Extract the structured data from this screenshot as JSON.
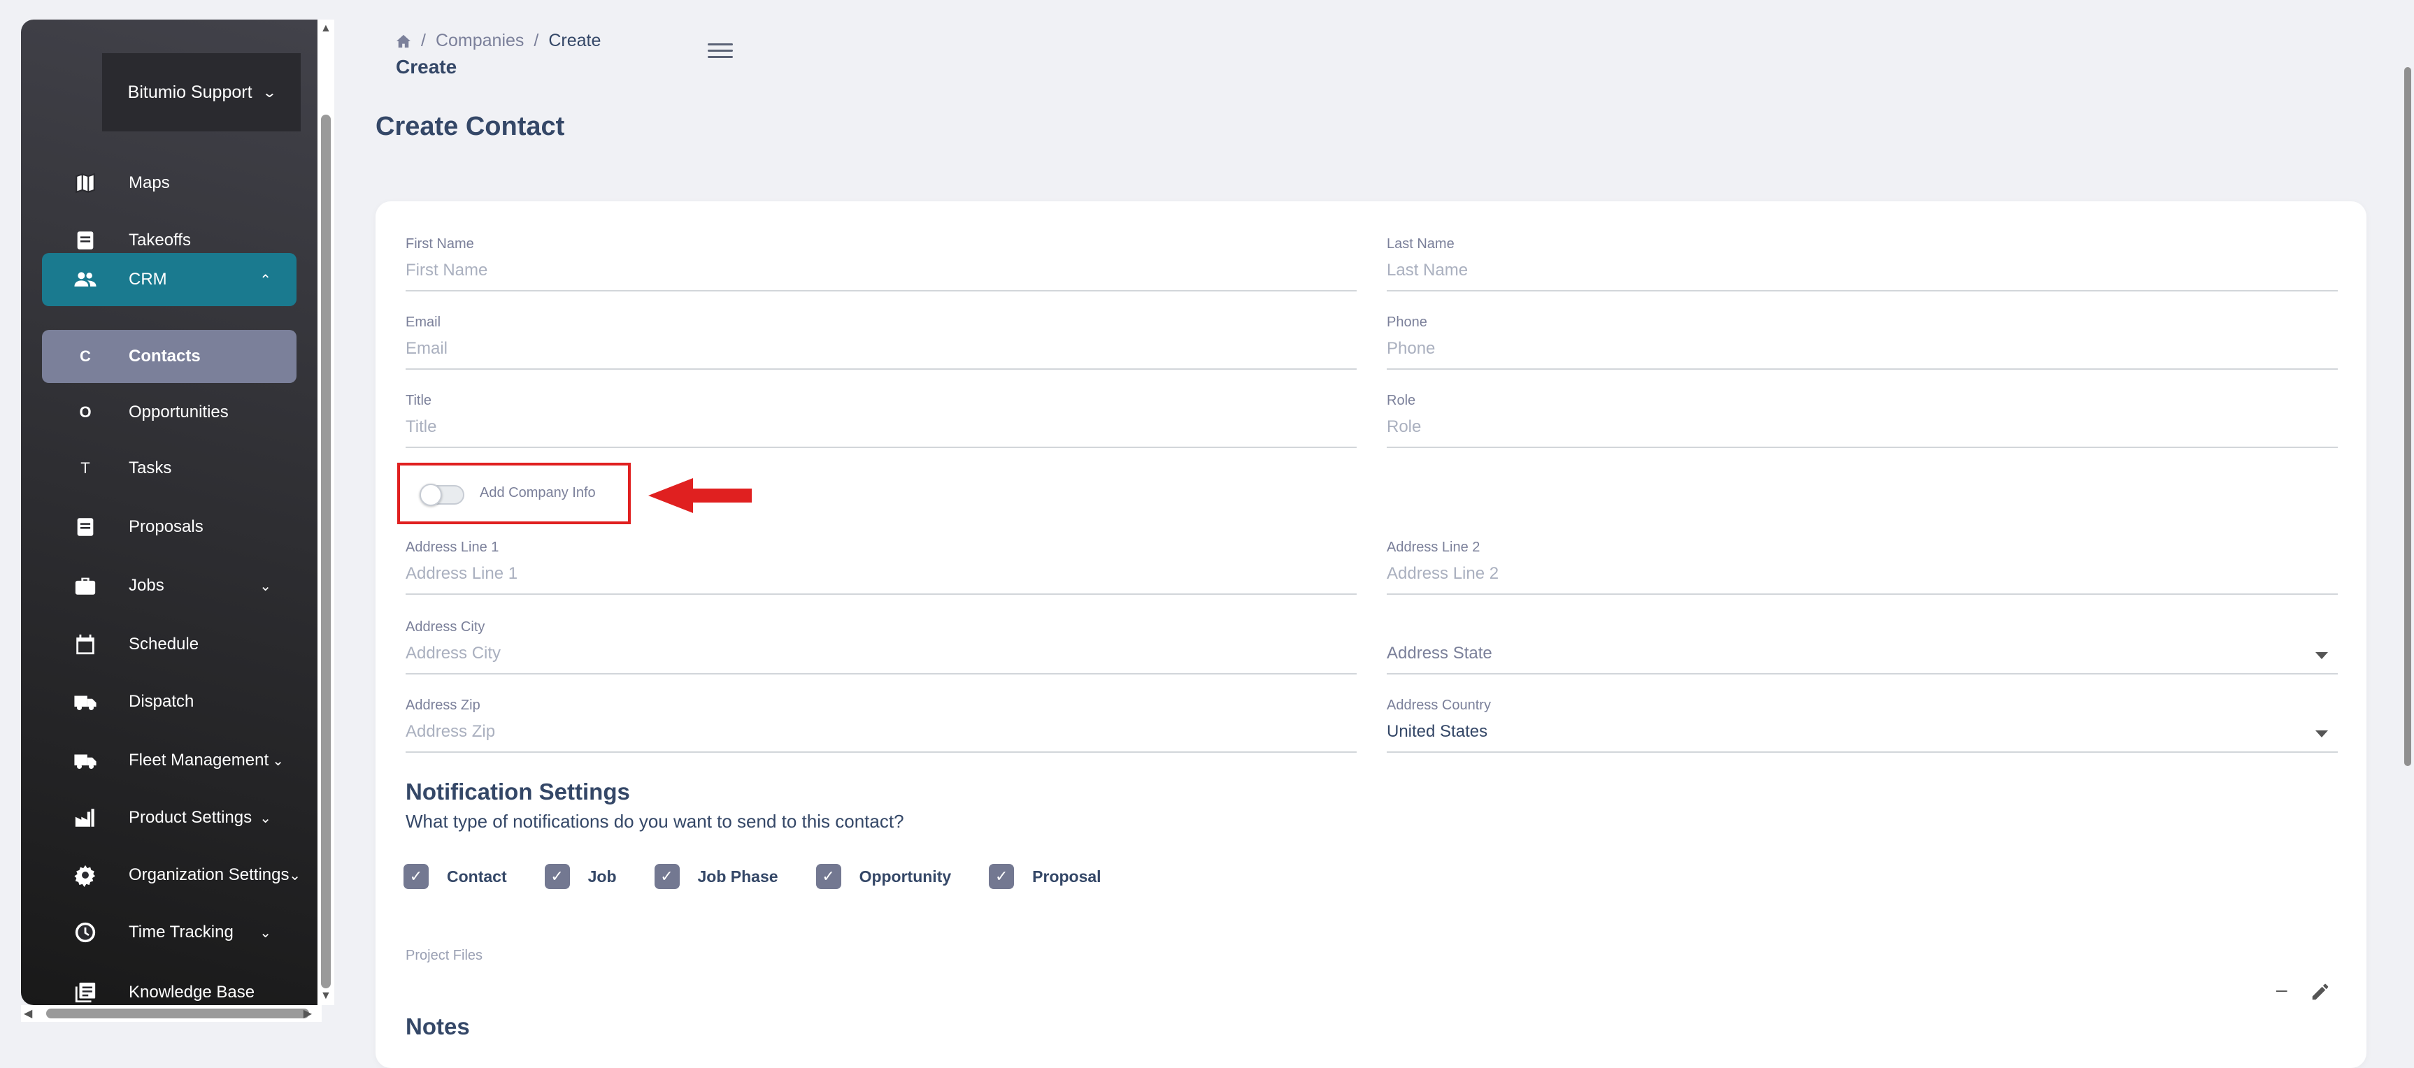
{
  "sidebar": {
    "brand": "Bitumio Support",
    "items": [
      {
        "label": "Maps",
        "icon": "map-icon"
      },
      {
        "label": "Takeoffs",
        "icon": "receipt-icon"
      },
      {
        "label": "CRM",
        "icon": "people-icon"
      },
      {
        "label": "Contacts",
        "letter": "C"
      },
      {
        "label": "Opportunities",
        "letter": "O"
      },
      {
        "label": "Tasks",
        "letter": "T"
      },
      {
        "label": "Proposals",
        "icon": "receipt-icon"
      },
      {
        "label": "Jobs",
        "icon": "briefcase-icon"
      },
      {
        "label": "Schedule",
        "icon": "calendar-icon"
      },
      {
        "label": "Dispatch",
        "icon": "truck-icon"
      },
      {
        "label": "Fleet Management",
        "icon": "truck-icon"
      },
      {
        "label": "Product Settings",
        "icon": "factory-icon"
      },
      {
        "label": "Organization Settings",
        "icon": "gear-icon"
      },
      {
        "label": "Time Tracking",
        "icon": "clock-icon"
      },
      {
        "label": "Knowledge Base",
        "icon": "library-icon"
      }
    ]
  },
  "breadcrumb": {
    "first": "Companies",
    "sep": "/",
    "current": "Create"
  },
  "page_sub": "Create",
  "page_title": "Create Contact",
  "form": {
    "first_name": {
      "label": "First Name",
      "placeholder": "First Name"
    },
    "last_name": {
      "label": "Last Name",
      "placeholder": "Last Name"
    },
    "email": {
      "label": "Email",
      "placeholder": "Email"
    },
    "phone": {
      "label": "Phone",
      "placeholder": "Phone"
    },
    "title": {
      "label": "Title",
      "placeholder": "Title"
    },
    "role": {
      "label": "Role",
      "placeholder": "Role"
    },
    "add_company_info": "Add Company Info",
    "address1": {
      "label": "Address Line 1",
      "placeholder": "Address Line 1"
    },
    "address2": {
      "label": "Address Line 2",
      "placeholder": "Address Line 2"
    },
    "city": {
      "label": "Address City",
      "placeholder": "Address City"
    },
    "state": {
      "placeholder": "Address State"
    },
    "zip": {
      "label": "Address Zip",
      "placeholder": "Address Zip"
    },
    "country": {
      "label": "Address Country",
      "value": "United States"
    }
  },
  "notifications": {
    "title": "Notification Settings",
    "question": "What type of notifications do you want to send to this contact?",
    "options": [
      "Contact",
      "Job",
      "Job Phase",
      "Opportunity",
      "Proposal"
    ]
  },
  "project_files": "Project Files",
  "notes": "Notes",
  "colors": {
    "accent": "#1a7a8f",
    "highlight": "#e02020"
  }
}
